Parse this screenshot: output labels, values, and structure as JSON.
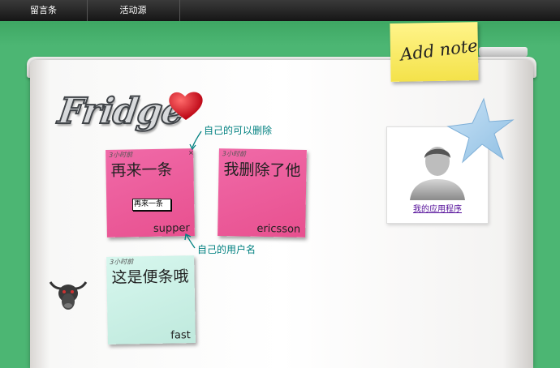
{
  "nav": {
    "tabs": [
      "留言条",
      "活动源"
    ]
  },
  "logo": {
    "text": "Fridge"
  },
  "add_note": {
    "label": "Add note"
  },
  "notes": [
    {
      "time": "3小时前",
      "text": "再来一条",
      "user": "supper",
      "edit_value": "再来一条"
    },
    {
      "time": "3小时前",
      "text": "我删除了他",
      "user": "ericsson"
    },
    {
      "time": "3小时前",
      "text": "这是便条哦",
      "user": "fast"
    }
  ],
  "delete_symbol": "×",
  "annotations": {
    "delete": "自己的可以删除",
    "username": "自己的用户名"
  },
  "app": {
    "link": "我的应用程序"
  },
  "colors": {
    "background": "#4cb673",
    "pink_note": "#e8508f",
    "mint_note": "#c8efe4",
    "sticky": "#fff48a",
    "annotation": "#008080"
  }
}
